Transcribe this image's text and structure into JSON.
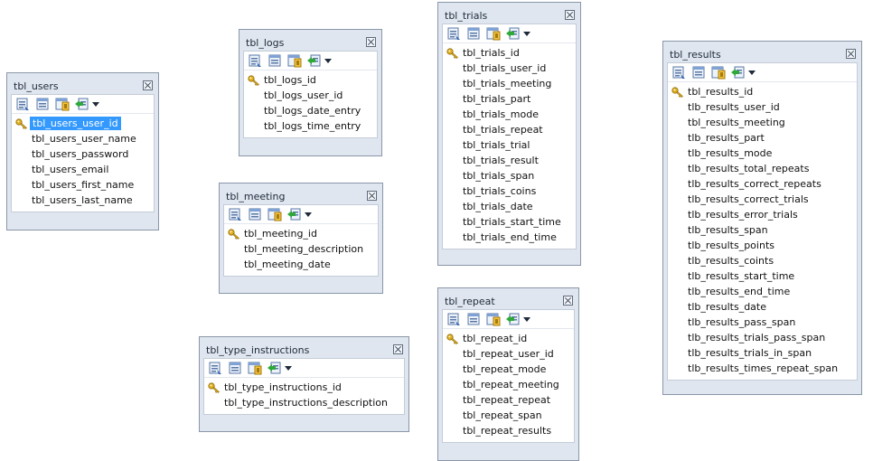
{
  "tables": [
    {
      "id": "users",
      "title": "tbl_users",
      "columns": [
        {
          "name": "tbl_users_user_id",
          "primary_key": true,
          "selected": true
        },
        {
          "name": "tbl_users_user_name"
        },
        {
          "name": "tbl_users_password"
        },
        {
          "name": "tbl_users_email"
        },
        {
          "name": "tbl_users_first_name"
        },
        {
          "name": "tbl_users_last_name"
        }
      ]
    },
    {
      "id": "logs",
      "title": "tbl_logs",
      "columns": [
        {
          "name": "tbl_logs_id",
          "primary_key": true
        },
        {
          "name": "tbl_logs_user_id"
        },
        {
          "name": "tbl_logs_date_entry"
        },
        {
          "name": "tbl_logs_time_entry"
        }
      ]
    },
    {
      "id": "meeting",
      "title": "tbl_meeting",
      "columns": [
        {
          "name": "tbl_meeting_id",
          "primary_key": true
        },
        {
          "name": "tbl_meeting_description"
        },
        {
          "name": "tbl_meeting_date"
        }
      ]
    },
    {
      "id": "type_instructions",
      "title": "tbl_type_instructions",
      "columns": [
        {
          "name": "tbl_type_instructions_id",
          "primary_key": true
        },
        {
          "name": "tbl_type_instructions_description"
        }
      ]
    },
    {
      "id": "trials",
      "title": "tbl_trials",
      "columns": [
        {
          "name": "tbl_trials_id",
          "primary_key": true
        },
        {
          "name": "tbl_trials_user_id"
        },
        {
          "name": "tbl_trials_meeting"
        },
        {
          "name": "tbl_trials_part"
        },
        {
          "name": "tbl_trials_mode"
        },
        {
          "name": "tbl_trials_repeat"
        },
        {
          "name": "tbl_trials_trial"
        },
        {
          "name": "tbl_trials_result"
        },
        {
          "name": "tbl_trials_span"
        },
        {
          "name": "tbl_trials_coins"
        },
        {
          "name": "tbl_trials_date"
        },
        {
          "name": "tbl_trials_start_time"
        },
        {
          "name": "tbl_trials_end_time"
        }
      ]
    },
    {
      "id": "repeat",
      "title": "tbl_repeat",
      "columns": [
        {
          "name": "tbl_repeat_id",
          "primary_key": true
        },
        {
          "name": "tbl_repeat_user_id"
        },
        {
          "name": "tbl_repeat_mode"
        },
        {
          "name": "tbl_repeat_meeting"
        },
        {
          "name": "tbl_repeat_repeat"
        },
        {
          "name": "tbl_repeat_span"
        },
        {
          "name": "tbl_repeat_results"
        }
      ]
    },
    {
      "id": "results",
      "title": "tbl_results",
      "columns": [
        {
          "name": "tbl_results_id",
          "primary_key": true
        },
        {
          "name": "tlb_results_user_id"
        },
        {
          "name": "tbl_results_meeting"
        },
        {
          "name": "tlb_results_part"
        },
        {
          "name": "tlb_results_mode"
        },
        {
          "name": "tlb_results_total_repeats"
        },
        {
          "name": "tlb_results_correct_repeats"
        },
        {
          "name": "tlb_results_correct_trials"
        },
        {
          "name": "tlb_results_error_trials"
        },
        {
          "name": "tlb_results_span"
        },
        {
          "name": "tlb_results_points"
        },
        {
          "name": "tlb_results_coints"
        },
        {
          "name": "tlb_results_start_time"
        },
        {
          "name": "tlb_results_end_time"
        },
        {
          "name": "tlb_results_date"
        },
        {
          "name": "tlb_results_pass_span"
        },
        {
          "name": "tlb_results_trials_pass_span"
        },
        {
          "name": "tlb_results_trials_in_span"
        },
        {
          "name": "tlb_results_times_repeat_span"
        }
      ]
    }
  ],
  "colors": {
    "frame": "#dfe6ef",
    "frame_border": "#8a96a8",
    "selection": "#3399ff",
    "key_gold": "#e0b020"
  },
  "icons": {
    "toolbar": [
      "properties-icon",
      "columns-icon",
      "keys-icon",
      "add-column-icon",
      "dropdown-arrow-icon"
    ],
    "primary_key": "key-icon",
    "close": "close-icon"
  }
}
